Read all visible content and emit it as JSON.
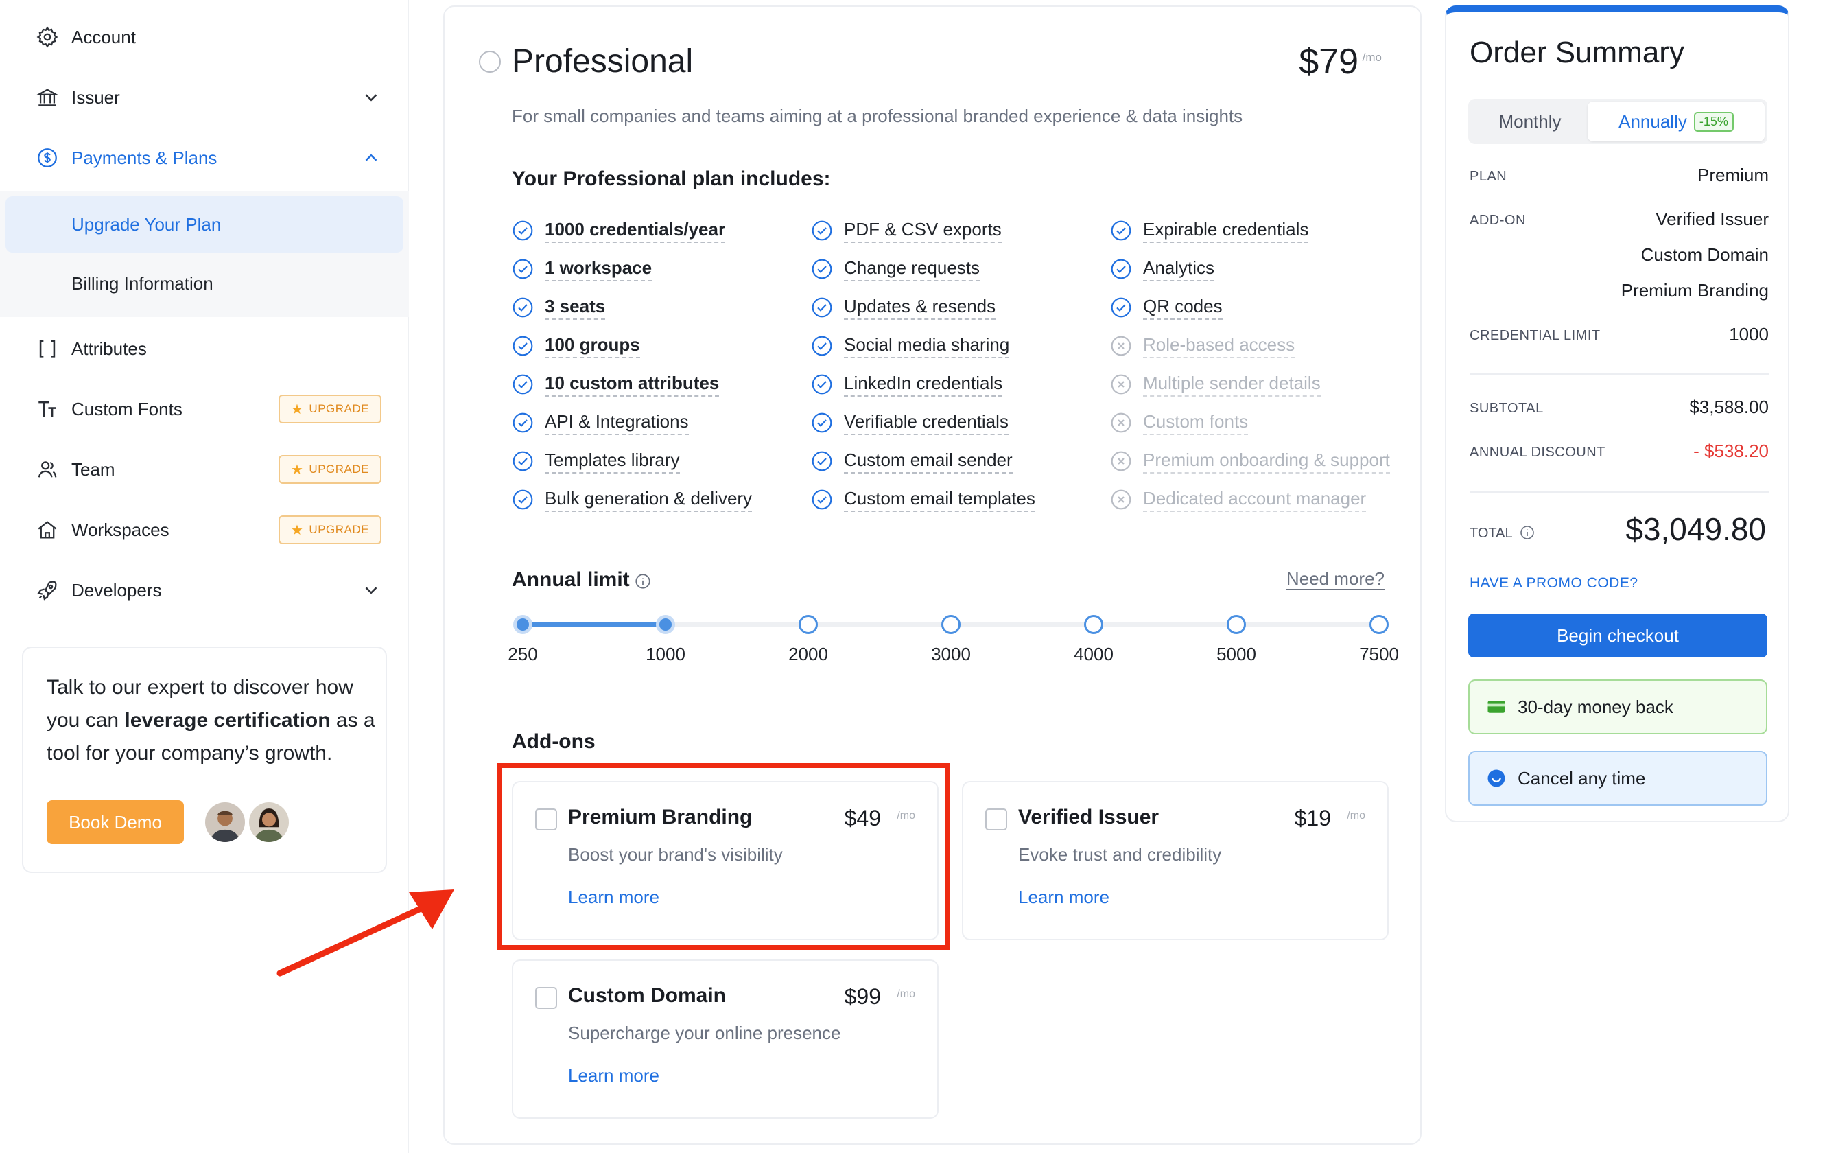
{
  "sidebar": {
    "items": [
      {
        "label": "Account",
        "icon": "gear-icon"
      },
      {
        "label": "Issuer",
        "icon": "bank-icon"
      },
      {
        "label": "Payments & Plans",
        "icon": "dollar-circle-icon"
      },
      {
        "label": "Attributes",
        "icon": "brackets-icon"
      },
      {
        "label": "Custom Fonts",
        "icon": "text-size-icon",
        "badge": "UPGRADE"
      },
      {
        "label": "Team",
        "icon": "team-icon",
        "badge": "UPGRADE"
      },
      {
        "label": "Workspaces",
        "icon": "home-icon",
        "badge": "UPGRADE"
      },
      {
        "label": "Developers",
        "icon": "rocket-icon"
      }
    ],
    "submenu": [
      {
        "label": "Upgrade Your Plan"
      },
      {
        "label": "Billing Information"
      }
    ],
    "expert_card": {
      "text_before": "Talk to our expert to discover how you can ",
      "text_bold": "leverage certification",
      "text_after": " as a tool for your company’s growth.",
      "button": "Book Demo"
    }
  },
  "plan": {
    "title": "Professional",
    "price": "$79",
    "per": "/mo",
    "description": "For small companies and teams aiming at a professional branded experience & data insights",
    "includes_title": "Your Professional plan includes:",
    "features": [
      [
        {
          "label": "1000 credentials/year",
          "on": true,
          "bold": true
        },
        {
          "label": "1 workspace",
          "on": true,
          "bold": true
        },
        {
          "label": "3 seats",
          "on": true,
          "bold": true
        },
        {
          "label": "100 groups",
          "on": true,
          "bold": true
        },
        {
          "label": "10 custom attributes",
          "on": true,
          "bold": true
        },
        {
          "label": "API & Integrations",
          "on": true,
          "bold": false
        },
        {
          "label": "Templates library",
          "on": true,
          "bold": false
        },
        {
          "label": "Bulk generation & delivery",
          "on": true,
          "bold": false
        }
      ],
      [
        {
          "label": "PDF & CSV exports",
          "on": true,
          "bold": false
        },
        {
          "label": "Change requests",
          "on": true,
          "bold": false
        },
        {
          "label": "Updates & resends",
          "on": true,
          "bold": false
        },
        {
          "label": "Social media sharing",
          "on": true,
          "bold": false
        },
        {
          "label": "LinkedIn credentials",
          "on": true,
          "bold": false
        },
        {
          "label": "Verifiable credentials",
          "on": true,
          "bold": false
        },
        {
          "label": "Custom email sender",
          "on": true,
          "bold": false
        },
        {
          "label": "Custom email templates",
          "on": true,
          "bold": false
        }
      ],
      [
        {
          "label": "Expirable credentials",
          "on": true,
          "bold": false
        },
        {
          "label": "Analytics",
          "on": true,
          "bold": false
        },
        {
          "label": "QR codes",
          "on": true,
          "bold": false
        },
        {
          "label": "Role-based access",
          "on": false,
          "bold": false
        },
        {
          "label": "Multiple sender details",
          "on": false,
          "bold": false
        },
        {
          "label": "Custom fonts",
          "on": false,
          "bold": false
        },
        {
          "label": "Premium onboarding & support",
          "on": false,
          "bold": false
        },
        {
          "label": "Dedicated account manager",
          "on": false,
          "bold": false
        }
      ]
    ],
    "annual_limit": {
      "title": "Annual limit",
      "need_more": "Need more?",
      "stops": [
        "250",
        "1000",
        "2000",
        "3000",
        "4000",
        "5000",
        "7500"
      ],
      "selected_index": 1
    },
    "addons_title": "Add-ons",
    "addons": [
      {
        "name": "Premium Branding",
        "price": "$49",
        "per": "/mo",
        "desc": "Boost your brand's visibility",
        "link": "Learn more",
        "checked": false
      },
      {
        "name": "Verified Issuer",
        "price": "$19",
        "per": "/mo",
        "desc": "Evoke trust and credibility",
        "link": "Learn more",
        "checked": false
      },
      {
        "name": "Custom Domain",
        "price": "$99",
        "per": "/mo",
        "desc": "Supercharge your online presence",
        "link": "Learn more",
        "checked": false
      }
    ]
  },
  "order": {
    "title": "Order Summary",
    "toggle": {
      "monthly": "Monthly",
      "annually": "Annually",
      "discount": "-15%",
      "selected": "annually"
    },
    "plan_label": "PLAN",
    "plan_value": "Premium",
    "addon_label": "ADD-ON",
    "addon_values": [
      "Verified Issuer",
      "Custom Domain",
      "Premium Branding"
    ],
    "limit_label": "CREDENTIAL LIMIT",
    "limit_value": "1000",
    "subtotal_label": "SUBTOTAL",
    "subtotal_value": "$3,588.00",
    "discount_label": "ANNUAL DISCOUNT",
    "discount_value": "- $538.20",
    "total_label": "TOTAL",
    "total_value": "$3,049.80",
    "promo": "HAVE A PROMO CODE?",
    "checkout": "Begin checkout",
    "money_back": "30-day money back",
    "cancel": "Cancel any time"
  },
  "colors": {
    "accent": "#1f6fe0",
    "highlight": "#ee2b12",
    "upgrade": "#f5a623",
    "discount": "#e53935"
  }
}
